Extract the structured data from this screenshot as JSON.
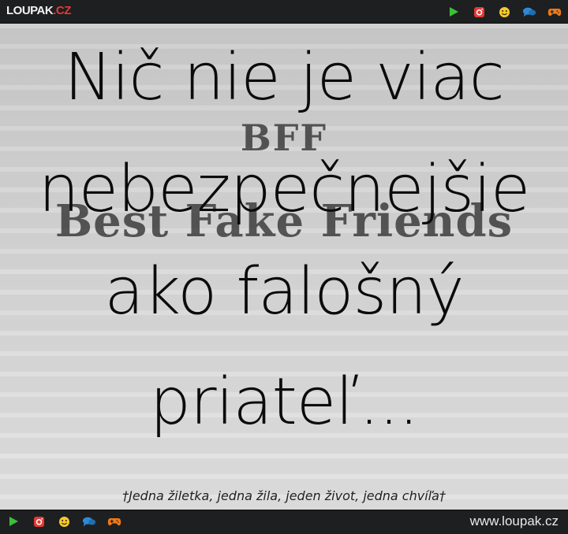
{
  "brand": {
    "name": "LOUPAK",
    "tld": ".CZ"
  },
  "icons": {
    "play": "play-icon",
    "instagram": "instagram-icon",
    "smiley": "smiley-icon",
    "chat": "chat-icon",
    "gamepad": "gamepad-icon"
  },
  "colors": {
    "play": "#3cbf3a",
    "instagram": "#e53935",
    "smiley": "#f7c928",
    "chat": "#2e8ad6",
    "gamepad": "#f07a17",
    "bar": "#1e1f20"
  },
  "image": {
    "bff_title": "BFF",
    "bff_subtitle": "Best Fake Friends"
  },
  "quote": {
    "line1": "Nič nie je viac",
    "line2": "nebezpečnejšie",
    "line3": "ako falošný",
    "line4": "priateľ..."
  },
  "signature": "†Jedna žiletka, jedna žila, jeden život, jedna chvíľa†",
  "footer": {
    "url": "www.loupak.cz"
  }
}
